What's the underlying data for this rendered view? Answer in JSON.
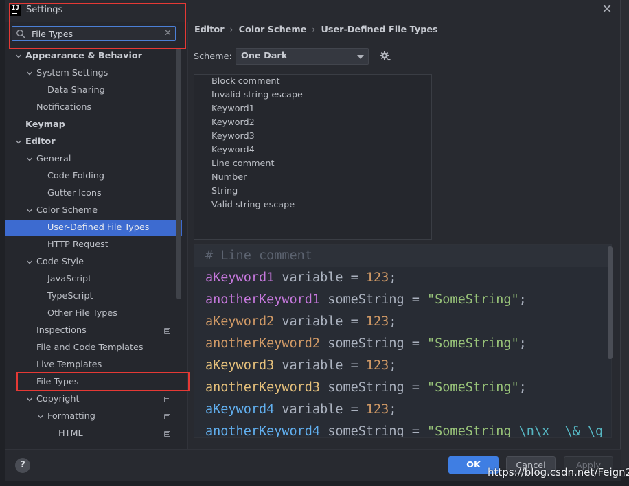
{
  "window": {
    "title": "Settings",
    "logo_text": "IJ"
  },
  "search": {
    "value": "File Types"
  },
  "tree": [
    {
      "label": "Appearance & Behavior",
      "arrow": "down",
      "bold": true,
      "indent": 0,
      "name": "tree-appearance-behavior"
    },
    {
      "label": "System Settings",
      "arrow": "down",
      "bold": false,
      "indent": 1,
      "name": "tree-system-settings"
    },
    {
      "label": "Data Sharing",
      "arrow": null,
      "bold": false,
      "indent": 2,
      "name": "tree-data-sharing"
    },
    {
      "label": "Notifications",
      "arrow": null,
      "bold": false,
      "indent": 1,
      "name": "tree-notifications"
    },
    {
      "label": "Keymap",
      "arrow": null,
      "bold": true,
      "indent": 0,
      "name": "tree-keymap"
    },
    {
      "label": "Editor",
      "arrow": "down",
      "bold": true,
      "indent": 0,
      "name": "tree-editor"
    },
    {
      "label": "General",
      "arrow": "down",
      "bold": false,
      "indent": 1,
      "name": "tree-general"
    },
    {
      "label": "Code Folding",
      "arrow": null,
      "bold": false,
      "indent": 2,
      "name": "tree-code-folding"
    },
    {
      "label": "Gutter Icons",
      "arrow": null,
      "bold": false,
      "indent": 2,
      "name": "tree-gutter-icons"
    },
    {
      "label": "Color Scheme",
      "arrow": "down",
      "bold": false,
      "indent": 1,
      "name": "tree-color-scheme"
    },
    {
      "label": "User-Defined File Types",
      "arrow": null,
      "bold": false,
      "indent": 2,
      "selected": true,
      "name": "tree-user-defined-file-types"
    },
    {
      "label": "HTTP Request",
      "arrow": null,
      "bold": false,
      "indent": 2,
      "name": "tree-http-request"
    },
    {
      "label": "Code Style",
      "arrow": "down",
      "bold": false,
      "indent": 1,
      "name": "tree-code-style"
    },
    {
      "label": "JavaScript",
      "arrow": null,
      "bold": false,
      "indent": 2,
      "name": "tree-javascript"
    },
    {
      "label": "TypeScript",
      "arrow": null,
      "bold": false,
      "indent": 2,
      "name": "tree-typescript"
    },
    {
      "label": "Other File Types",
      "arrow": null,
      "bold": false,
      "indent": 2,
      "name": "tree-other-file-types"
    },
    {
      "label": "Inspections",
      "arrow": null,
      "bold": false,
      "indent": 1,
      "project": true,
      "name": "tree-inspections"
    },
    {
      "label": "File and Code Templates",
      "arrow": null,
      "bold": false,
      "indent": 1,
      "name": "tree-file-code-templates"
    },
    {
      "label": "Live Templates",
      "arrow": null,
      "bold": false,
      "indent": 1,
      "name": "tree-live-templates"
    },
    {
      "label": "File Types",
      "arrow": null,
      "bold": false,
      "indent": 1,
      "name": "tree-file-types"
    },
    {
      "label": "Copyright",
      "arrow": "down",
      "bold": false,
      "indent": 1,
      "project": true,
      "name": "tree-copyright"
    },
    {
      "label": "Formatting",
      "arrow": "down",
      "bold": false,
      "indent": 2,
      "project": true,
      "name": "tree-formatting"
    },
    {
      "label": "HTML",
      "arrow": null,
      "bold": false,
      "indent": 3,
      "project": true,
      "name": "tree-html"
    }
  ],
  "breadcrumb": [
    "Editor",
    "Color Scheme",
    "User-Defined File Types"
  ],
  "scheme": {
    "label": "Scheme:",
    "value": "One Dark"
  },
  "attributes": [
    "Block comment",
    "Invalid string escape",
    "Keyword1",
    "Keyword2",
    "Keyword3",
    "Keyword4",
    "Line comment",
    "Number",
    "String",
    "Valid string escape"
  ],
  "preview": [
    [
      {
        "t": "# Line comment",
        "c": "comment"
      }
    ],
    [
      {
        "t": "aKeyword1",
        "c": "k1"
      },
      {
        "t": " variable = ",
        "c": "var"
      },
      {
        "t": "123",
        "c": "num"
      },
      {
        "t": ";",
        "c": "var"
      }
    ],
    [
      {
        "t": "anotherKeyword1",
        "c": "k1"
      },
      {
        "t": " someString = ",
        "c": "var"
      },
      {
        "t": "\"SomeString\"",
        "c": "str"
      },
      {
        "t": ";",
        "c": "var"
      }
    ],
    [
      {
        "t": "aKeyword2",
        "c": "k2"
      },
      {
        "t": " variable = ",
        "c": "var"
      },
      {
        "t": "123",
        "c": "num"
      },
      {
        "t": ";",
        "c": "var"
      }
    ],
    [
      {
        "t": "anotherKeyword2",
        "c": "k2"
      },
      {
        "t": " someString = ",
        "c": "var"
      },
      {
        "t": "\"SomeString\"",
        "c": "str"
      },
      {
        "t": ";",
        "c": "var"
      }
    ],
    [
      {
        "t": "aKeyword3",
        "c": "k3"
      },
      {
        "t": " variable = ",
        "c": "var"
      },
      {
        "t": "123",
        "c": "num"
      },
      {
        "t": ";",
        "c": "var"
      }
    ],
    [
      {
        "t": "anotherKeyword3",
        "c": "k3"
      },
      {
        "t": " someString = ",
        "c": "var"
      },
      {
        "t": "\"SomeString\"",
        "c": "str"
      },
      {
        "t": ";",
        "c": "var"
      }
    ],
    [
      {
        "t": "aKeyword4",
        "c": "k4"
      },
      {
        "t": " variable = ",
        "c": "var"
      },
      {
        "t": "123",
        "c": "num"
      },
      {
        "t": ";",
        "c": "var"
      }
    ],
    [
      {
        "t": "anotherKeyword4",
        "c": "k4"
      },
      {
        "t": " someString = ",
        "c": "var"
      },
      {
        "t": "\"SomeString ",
        "c": "str"
      },
      {
        "t": "\\n\\x  \\& \\g",
        "c": "esc"
      },
      {
        "t": " \"",
        "c": "str"
      }
    ]
  ],
  "buttons": {
    "help": "?",
    "ok": "OK",
    "cancel": "Cancel",
    "apply": "Apply"
  },
  "watermark": "https://blog.csdn.net/Feign2"
}
